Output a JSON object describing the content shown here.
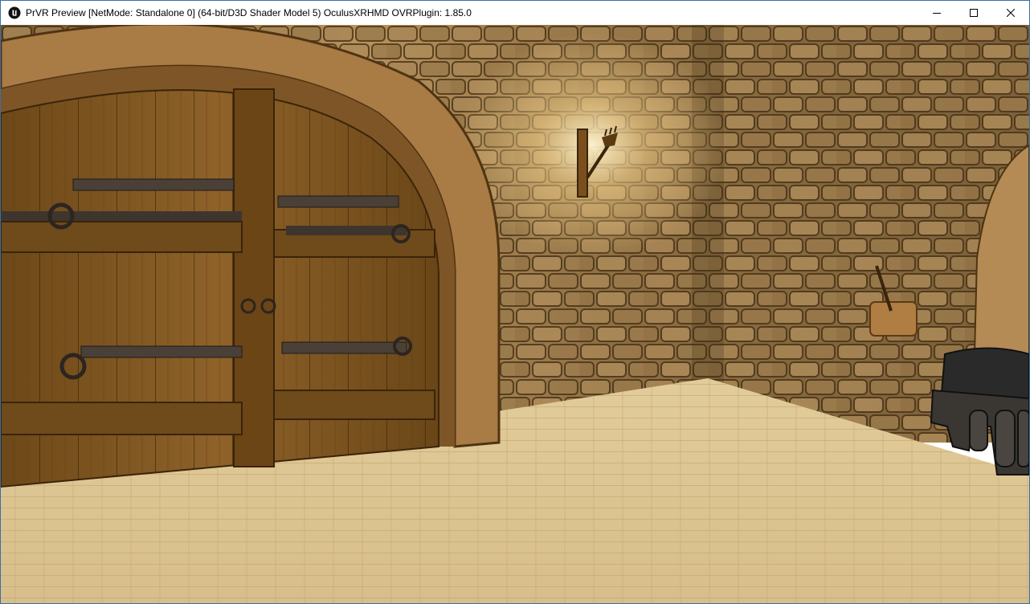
{
  "window": {
    "title": "PrVR Preview [NetMode: Standalone 0]  (64-bit/D3D Shader Model 5) OculusXRHMD OVRPlugin: 1.85.0",
    "app_icon": "unreal-engine-logo",
    "controls": {
      "minimize_icon": "minimize-icon",
      "maximize_icon": "maximize-icon",
      "close_icon": "close-icon"
    }
  },
  "scene": {
    "description_icon": "game-viewport",
    "colors": {
      "wall_stone": "#8a6a3e",
      "floor": "#dcc596",
      "door_wood": "#7a5220",
      "torch_glow": "#fff3c8",
      "arch_stone": "#b08550"
    }
  }
}
